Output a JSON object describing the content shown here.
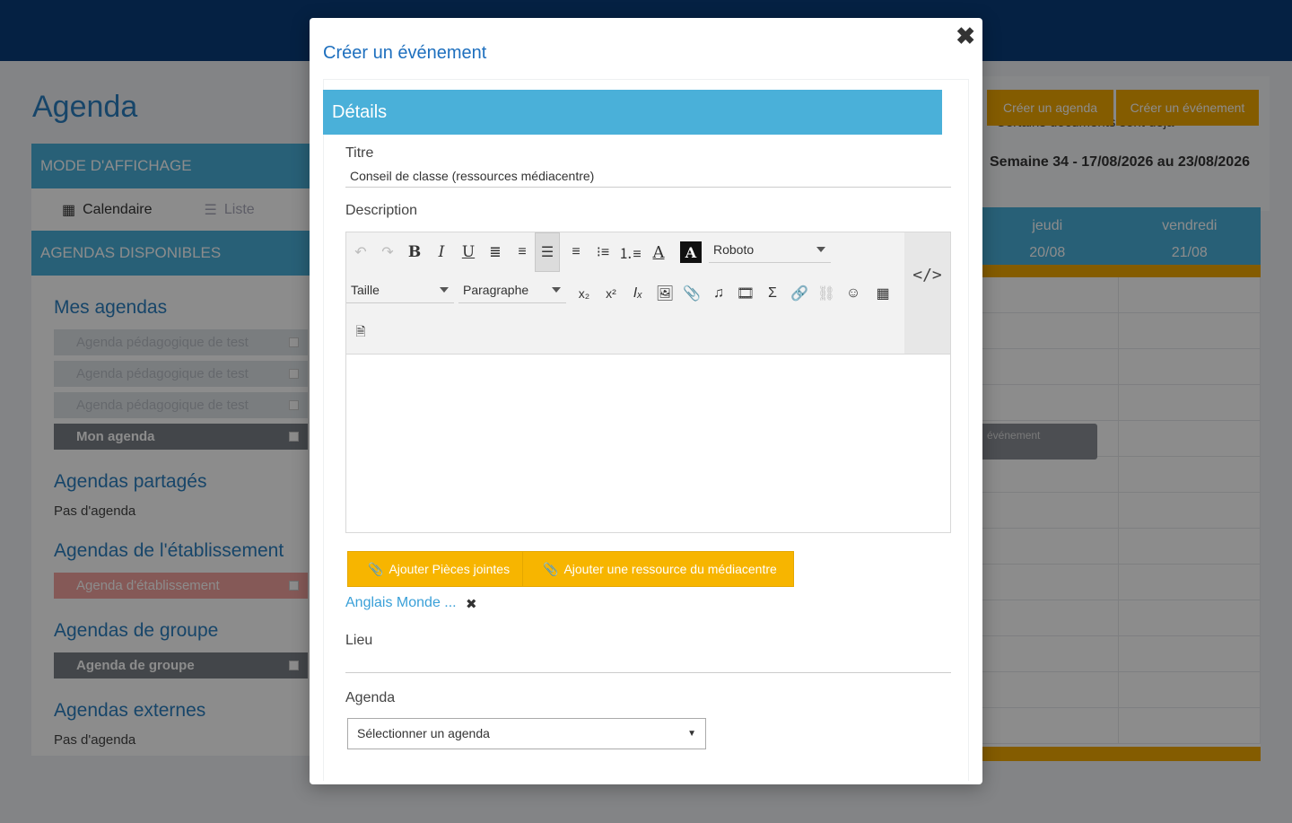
{
  "page": {
    "title": "Agenda",
    "display_mode_header": "MODE D'AFFICHAGE",
    "view_modes": {
      "calendar": "Calendaire",
      "list": "Liste"
    },
    "available_header": "AGENDAS DISPONIBLES",
    "sections": {
      "mine": "Mes agendas",
      "shared": "Agendas partagés",
      "school": "Agendas de l'établissement",
      "group": "Agendas de groupe",
      "external": "Agendas externes"
    },
    "my_agendas": [
      "Agenda pédagogique de test",
      "Agenda pédagogique de test",
      "Agenda pédagogique de test",
      "Mon agenda"
    ],
    "no_agenda": "Pas d'agenda",
    "school_agenda": "Agenda d'établissement",
    "group_agenda": "Agenda de groupe",
    "create_agenda_btn": "Créer un agenda",
    "create_event_btn": "Créer un événement",
    "warning_text": "Certains documents sont déjà",
    "week_label": "Semaine 34 - 17/08/2026 au 23/08/2026",
    "days": [
      {
        "name": "jeudi",
        "date": "20/08"
      },
      {
        "name": "vendredi",
        "date": "21/08"
      }
    ],
    "event_label": "événement"
  },
  "modal": {
    "title": "Créer un événement",
    "close_glyph": "✖",
    "section_title": "Détails",
    "title_label": "Titre",
    "title_value": "Conseil de classe (ressources médiacentre)",
    "description_label": "Description",
    "font_family": "Roboto",
    "size_label": "Taille",
    "paragraph_label": "Paragraphe",
    "attach_button": "Ajouter Pièces jointes",
    "resource_button": "Ajouter une ressource du médiacentre",
    "resource_name": "Anglais Monde ...",
    "remove_glyph": "✖",
    "location_label": "Lieu",
    "agenda_label": "Agenda",
    "agenda_select": "Sélectionner un agenda"
  },
  "colors": {
    "topbar": "#0a3d7a",
    "section_blue": "#4ab0d9",
    "title_blue": "#1d6fbe",
    "button_orange": "#f7b500",
    "link_blue": "#3aa0d8"
  }
}
